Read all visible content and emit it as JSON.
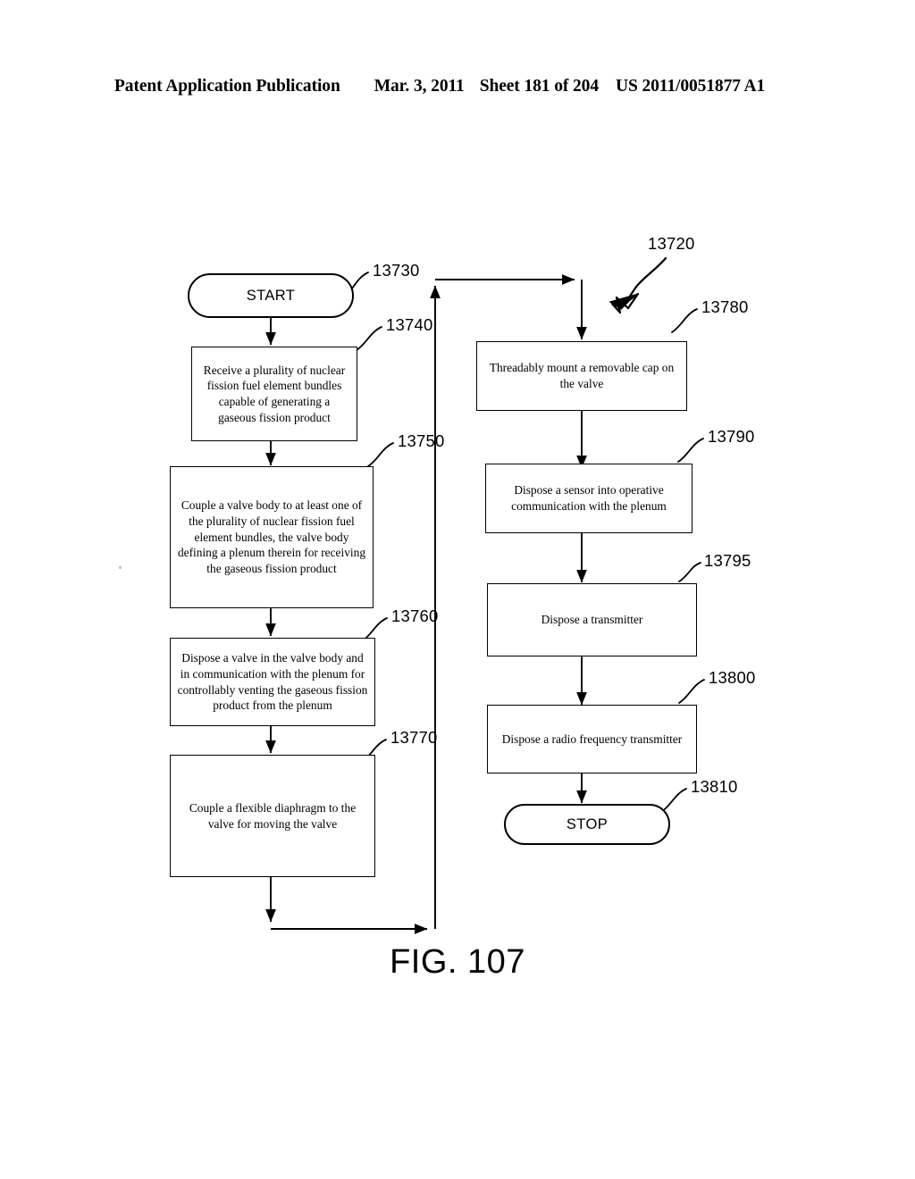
{
  "header": {
    "publication": "Patent Application Publication",
    "date": "Mar. 3, 2011",
    "sheet": "Sheet 181 of 204",
    "number": "US 2011/0051877 A1"
  },
  "figure": {
    "caption": "FIG. 107",
    "diagram_ref": "13720"
  },
  "nodes": {
    "start": {
      "ref": "13730",
      "text": "START"
    },
    "n13740": {
      "ref": "13740",
      "text": "Receive a plurality of nuclear fission fuel element bundles capable of generating a gaseous fission product"
    },
    "n13750": {
      "ref": "13750",
      "text": "Couple a valve body to at least one of the plurality of nuclear fission fuel element bundles, the valve body defining a plenum therein for receiving the gaseous fission product"
    },
    "n13760": {
      "ref": "13760",
      "text": "Dispose a valve in the valve body and in communication with the plenum for controllably venting the gaseous fission product from the plenum"
    },
    "n13770": {
      "ref": "13770",
      "text": "Couple a flexible diaphragm to the valve for moving the valve"
    },
    "n13780": {
      "ref": "13780",
      "text": "Threadably mount a removable cap on the valve"
    },
    "n13790": {
      "ref": "13790",
      "text": "Dispose a sensor into operative communication with the plenum"
    },
    "n13795": {
      "ref": "13795",
      "text": "Dispose a transmitter"
    },
    "n13800": {
      "ref": "13800",
      "text": "Dispose a radio frequency transmitter"
    },
    "stop": {
      "ref": "13810",
      "text": "STOP"
    }
  },
  "colors": {
    "ink": "#000000",
    "paper": "#ffffff"
  }
}
